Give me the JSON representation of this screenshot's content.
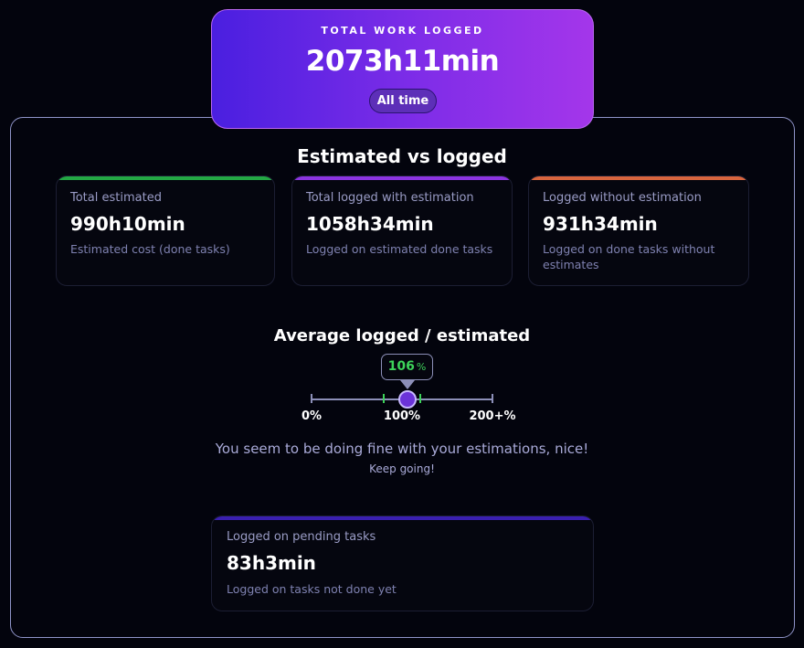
{
  "hero": {
    "label": "TOTAL WORK LOGGED",
    "value": "2073h11min",
    "period_button": "All time"
  },
  "estimated_section": {
    "title": "Estimated vs logged",
    "cards": [
      {
        "label": "Total estimated",
        "value": "990h10min",
        "description": "Estimated cost (done tasks)",
        "accent": "#23a844"
      },
      {
        "label": "Total logged with estimation",
        "value": "1058h34min",
        "description": "Logged on estimated done tasks",
        "accent": "#8b34e0"
      },
      {
        "label": "Logged without estimation",
        "value": "931h34min",
        "description": "Logged on done tasks without estimates",
        "accent": "#d8653e"
      }
    ]
  },
  "average_section": {
    "title": "Average logged / estimated",
    "ratio_value": "106",
    "ratio_unit": "%",
    "ratio_fraction": 0.53,
    "scale_labels": [
      "0%",
      "100%",
      "200+%"
    ],
    "message": "You seem to be doing fine with your estimations, nice!",
    "sub_message": "Keep going!"
  },
  "pending": {
    "label": "Logged on pending tasks",
    "value": "83h3min",
    "description": "Logged on tasks not done yet",
    "accent": "#3a1fb0"
  },
  "colors": {
    "ratio_good": "#3dd35a",
    "tick_mark": "#3dd35a",
    "gauge_line": "#8c8fb8"
  }
}
